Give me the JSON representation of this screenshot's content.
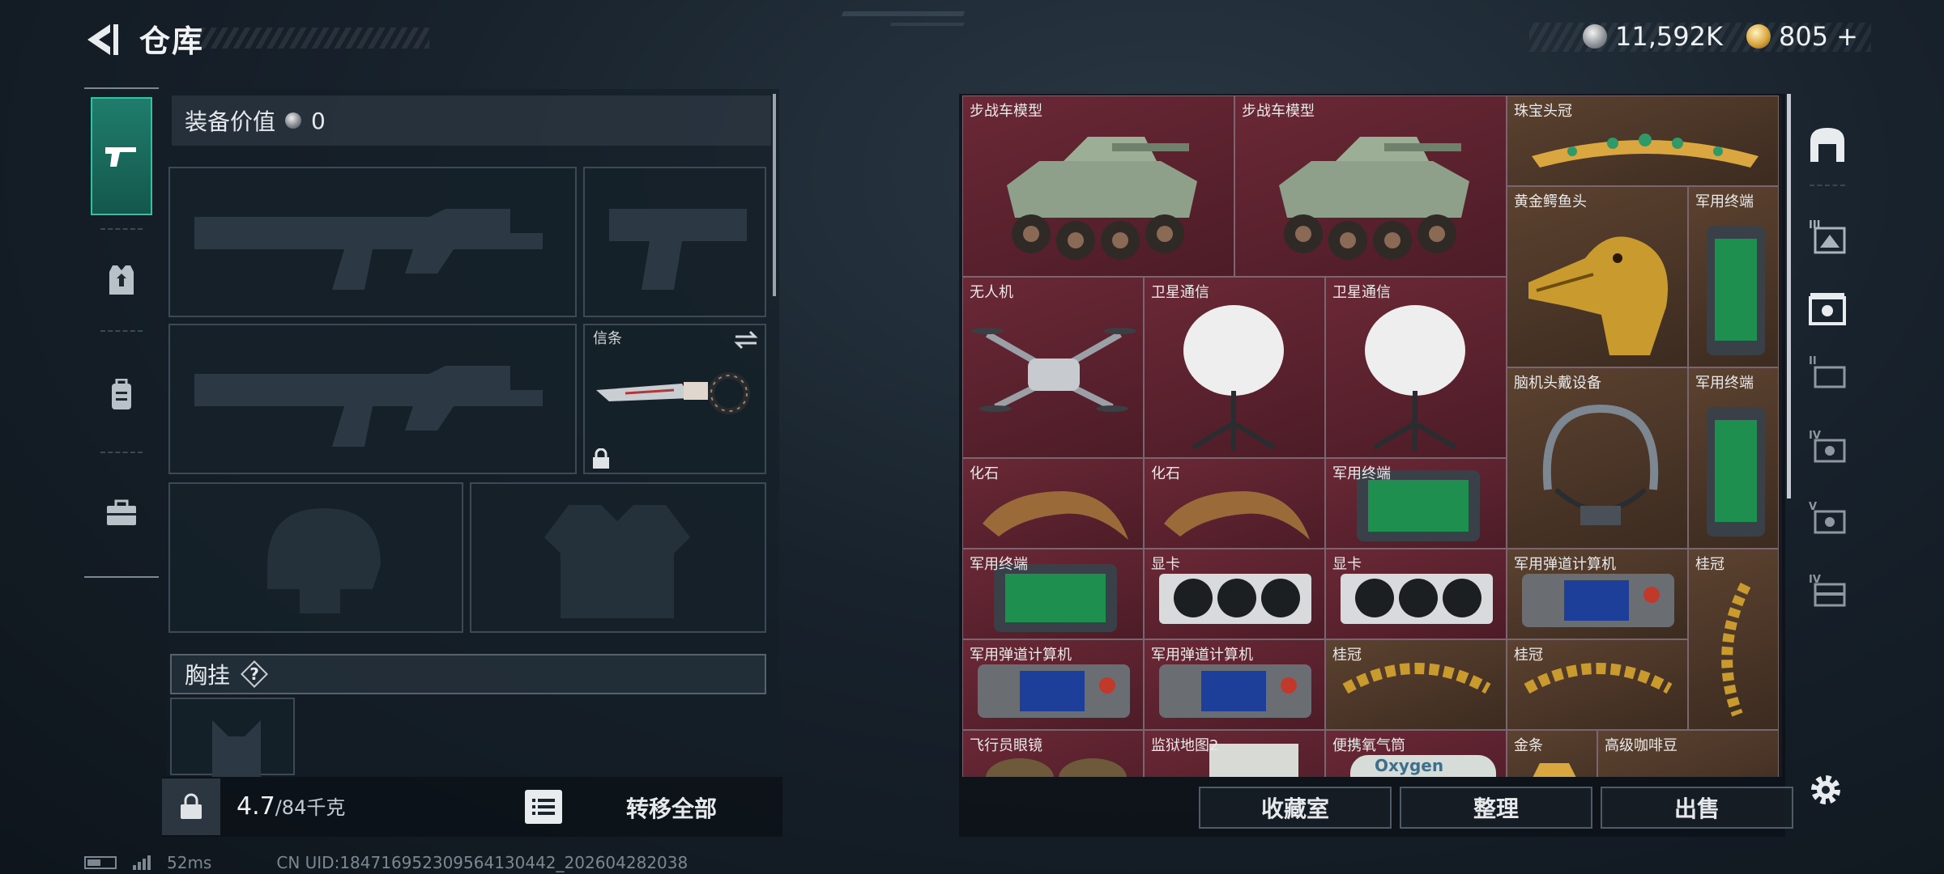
{
  "header": {
    "title": "仓库",
    "currency_silver": "11,592K",
    "currency_gold": "805",
    "gold_add": "+"
  },
  "loadout": {
    "equipment_value_label": "装备价值",
    "equipment_value": "0",
    "knife_slot_label": "信条",
    "chest_rig_label": "胸挂",
    "chest_rig_help": "?"
  },
  "footer_left": {
    "weight_current": "4.7",
    "weight_max": "/84千克",
    "transfer_all": "转移全部"
  },
  "inventory": {
    "items": [
      {
        "label": "步战车模型"
      },
      {
        "label": "步战车模型"
      },
      {
        "label": "珠宝头冠"
      },
      {
        "label": "黄金鳄鱼头"
      },
      {
        "label": "军用终端"
      },
      {
        "label": "无人机"
      },
      {
        "label": "卫星通信"
      },
      {
        "label": "卫星通信"
      },
      {
        "label": "脑机头戴设备"
      },
      {
        "label": "军用终端"
      },
      {
        "label": "化石"
      },
      {
        "label": "化石"
      },
      {
        "label": "军用终端"
      },
      {
        "label": "军用终端"
      },
      {
        "label": "显卡"
      },
      {
        "label": "显卡"
      },
      {
        "label": "军用弹道计算机"
      },
      {
        "label": "桂冠"
      },
      {
        "label": "军用弹道计算机"
      },
      {
        "label": "军用弹道计算机"
      },
      {
        "label": "桂冠"
      },
      {
        "label": "桂冠"
      },
      {
        "label": "飞行员眼镜"
      },
      {
        "label": "监狱地图2"
      },
      {
        "label": "便携氧气筒"
      },
      {
        "label": "金条"
      },
      {
        "label": "高级咖啡豆"
      }
    ],
    "oxygen_text": "Oxygen",
    "buttons": {
      "collection": "收藏室",
      "organize": "整理",
      "sell": "出售"
    }
  },
  "right_nav": {
    "tiers": [
      "III",
      "II",
      "IV",
      "V",
      "IV"
    ]
  },
  "status_bar": {
    "ping": "52ms",
    "uid": "CN UID:184716952309564130442_202604282038"
  },
  "colors": {
    "accent_teal": "#1f7d6c",
    "cell_red": "#6b2836",
    "cell_brown": "#5c4230"
  }
}
